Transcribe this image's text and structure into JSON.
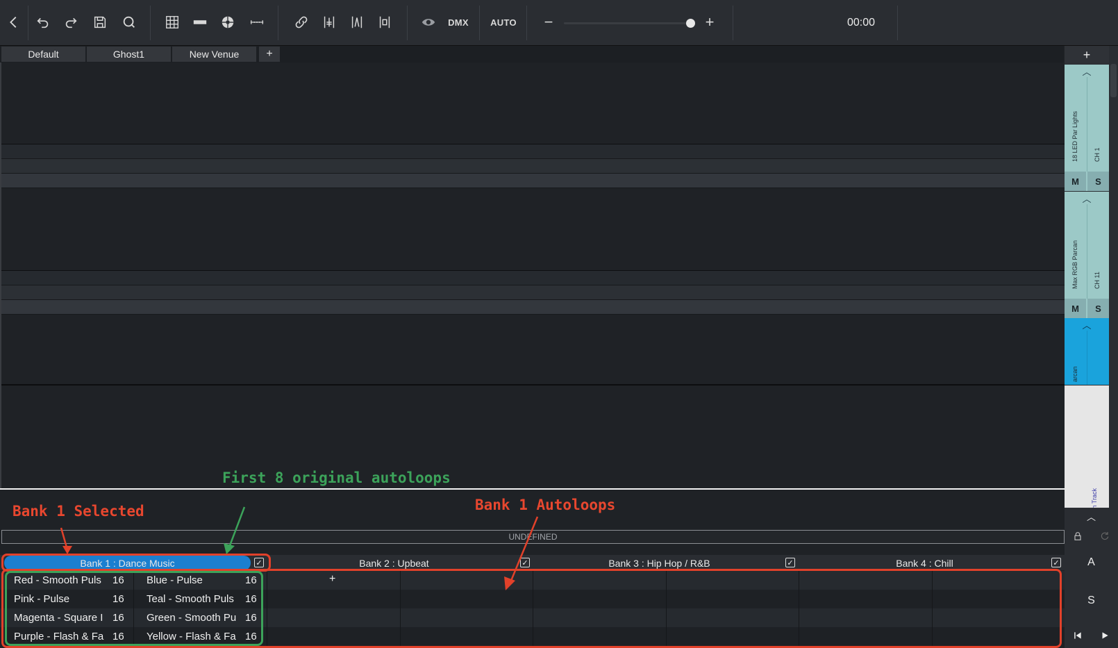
{
  "toolbar": {
    "buttons": [
      "back-icon",
      "undo-icon",
      "redo-icon",
      "save-icon",
      "quantize-icon",
      "grid-icon",
      "bar-icon",
      "color-wheel-icon",
      "ruler-icon",
      "link-icon",
      "align-left-icon",
      "distribute-icon",
      "align-center-icon",
      "visibility-icon"
    ],
    "dmx_label": "DMX",
    "auto_label": "AUTO",
    "zoom_minus": "−",
    "zoom_plus": "+",
    "time": "00:00"
  },
  "tabs": [
    {
      "label": "Default"
    },
    {
      "label": "Ghost1"
    },
    {
      "label": "New Venue"
    }
  ],
  "tab_add": "+",
  "right_panel": {
    "add": "+",
    "tracks": [
      {
        "name": "18 LED Par Lights",
        "channel": "CH 1",
        "mute": "M",
        "solo": "S"
      },
      {
        "name": "Max RGB Parcan",
        "channel": "CH 11",
        "mute": "M",
        "solo": "S"
      },
      {
        "name": "arcan",
        "channel": ""
      }
    ],
    "main_track": "Main Track",
    "collapse": "^"
  },
  "autoloops": {
    "undefined_label": "UNDEFINED",
    "banks": [
      {
        "label": "Bank 1 : Dance Music",
        "checked": true,
        "selected": true
      },
      {
        "label": "Bank 2 : Upbeat",
        "checked": true,
        "selected": false
      },
      {
        "label": "Bank 3 : Hip Hop / R&B",
        "checked": true,
        "selected": false
      },
      {
        "label": "Bank 4 : Chill",
        "checked": true,
        "selected": false
      }
    ],
    "loops": [
      {
        "name": "Red - Smooth Puls",
        "count": "16"
      },
      {
        "name": "Blue - Pulse",
        "count": "16"
      },
      {
        "name": "Pink - Pulse",
        "count": "16"
      },
      {
        "name": "Teal - Smooth Puls",
        "count": "16"
      },
      {
        "name": "Magenta - Square I",
        "count": "16"
      },
      {
        "name": "Green - Smooth Pu",
        "count": "16"
      },
      {
        "name": "Purple - Flash & Fa",
        "count": "16"
      },
      {
        "name": "Yellow - Flash & Fa",
        "count": "16"
      }
    ],
    "add_label": "+",
    "side_buttons": {
      "a": "A",
      "s": "S"
    }
  },
  "annotations": {
    "first8": "First 8 original autoloops",
    "bank1_selected": "Bank 1 Selected",
    "bank1_autoloops": "Bank 1 Autoloops"
  },
  "colors": {
    "accent_blue": "#1b7fd0",
    "track_teal": "#9cc9c7",
    "track_blue": "#1aa3dc",
    "annotation_red": "#e8472f",
    "annotation_green": "#3ca35a"
  }
}
